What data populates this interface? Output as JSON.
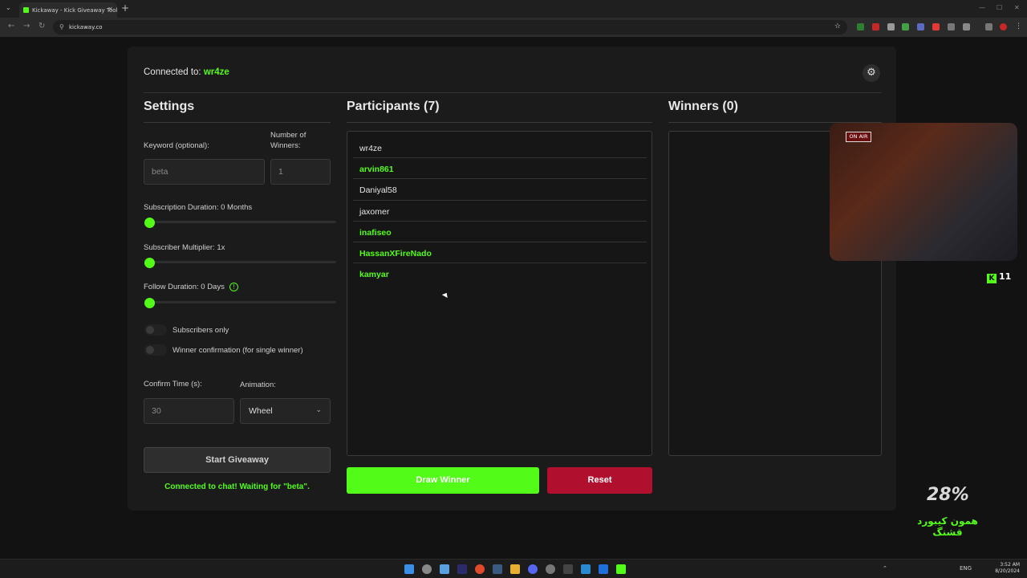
{
  "browser": {
    "tab_title": "Kickaway - Kick Giveaway Tool",
    "url": "kickaway.co"
  },
  "header": {
    "connected_label": "Connected to:",
    "connected_user": "wr4ze"
  },
  "settings": {
    "title": "Settings",
    "keyword_label": "Keyword (optional):",
    "keyword_value": "beta",
    "winners_label": "Number of Winners:",
    "winners_value": "1",
    "sub_duration_label": "Subscription Duration: 0 Months",
    "sub_multiplier_label": "Subscriber Multiplier: 1x",
    "follow_duration_label": "Follow Duration:  0  Days",
    "subscribers_only_label": "Subscribers only",
    "winner_confirmation_label": "Winner confirmation (for single winner)",
    "confirm_time_label": "Confirm Time (s):",
    "confirm_time_value": "30",
    "animation_label": "Animation:",
    "animation_value": "Wheel",
    "start_button": "Start Giveaway",
    "status": "Connected to chat! Waiting for \"beta\"."
  },
  "participants": {
    "title": "Participants (7)",
    "items": [
      {
        "name": "wr4ze",
        "subscriber": false
      },
      {
        "name": "arvin861",
        "subscriber": true
      },
      {
        "name": "Daniyal58",
        "subscriber": false
      },
      {
        "name": "jaxomer",
        "subscriber": false
      },
      {
        "name": "inafiseo",
        "subscriber": true
      },
      {
        "name": "HassanXFireNado",
        "subscriber": true
      },
      {
        "name": "kamyar",
        "subscriber": true
      }
    ]
  },
  "winners": {
    "title": "Winners (0)"
  },
  "actions": {
    "draw": "Draw Winner",
    "reset": "Reset"
  },
  "overlay": {
    "on_air": "ON AIR",
    "kick_count": "11",
    "percent": "28%",
    "persian_text": "همون کیبورد قشنگ"
  },
  "taskbar": {
    "lang": "ENG",
    "time": "3:52 AM",
    "date": "8/20/2024"
  },
  "colors": {
    "accent": "#53fc18",
    "reset": "#b0102e",
    "background": "#121212",
    "card": "#1b1b1b"
  }
}
